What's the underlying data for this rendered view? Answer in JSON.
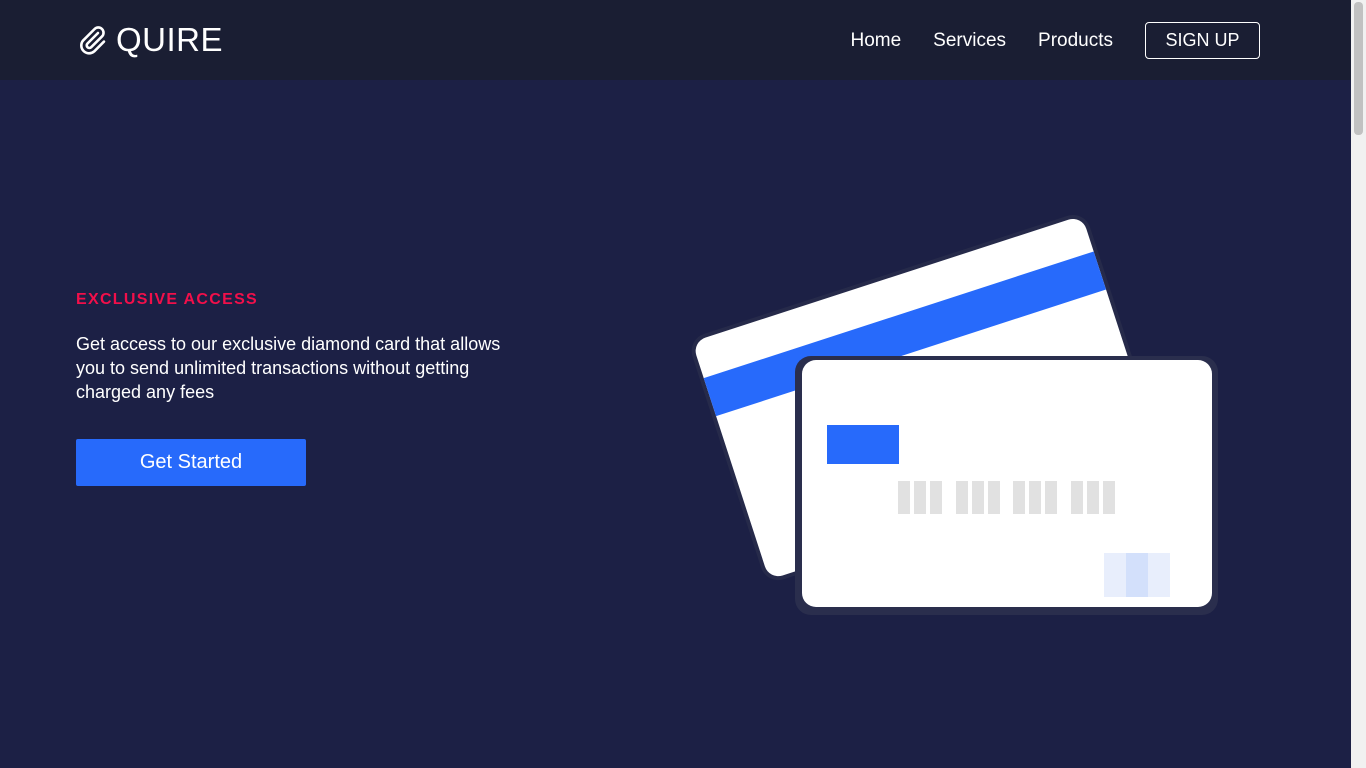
{
  "navbar": {
    "logo_text": "QUIRE",
    "logo_icon": "paperclip-icon",
    "links": [
      "Home",
      "Services",
      "Products"
    ],
    "signup_label": "SIGN UP"
  },
  "hero": {
    "eyebrow": "EXCLUSIVE ACCESS",
    "description": "Get access to our exclusive diamond card that allows you to send unlimited transactions without getting charged any fees",
    "cta_label": "Get Started"
  },
  "illustration": {
    "name": "credit-cards-illustration"
  },
  "colors": {
    "background": "#1c2045",
    "navbar": "#1a1e33",
    "accent": "#276afb",
    "eyebrow": "#f20f4a",
    "text": "#ffffff"
  }
}
